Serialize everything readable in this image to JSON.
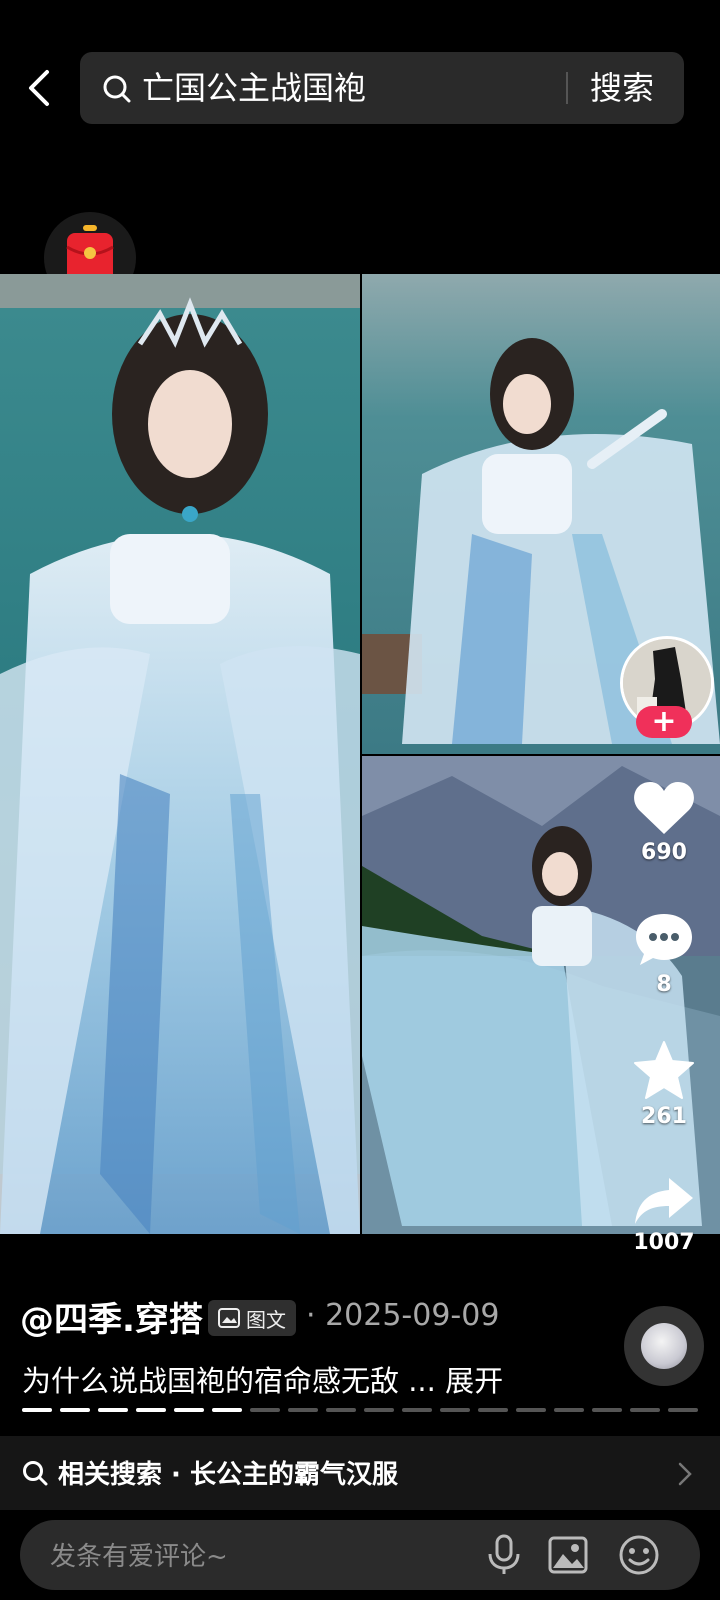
{
  "header": {
    "query": "亡国公主战国袍",
    "search_label": "搜索"
  },
  "post": {
    "author": "@四季.穿搭",
    "type_badge": "图文",
    "date": "· 2025-09-09",
    "description": "为什么说战国袍的宿命感无敌 ... 展开",
    "progress": {
      "total": 18,
      "current": 6
    }
  },
  "actions": {
    "likes": "690",
    "comments": "8",
    "favorites": "261",
    "shares": "1007"
  },
  "related": {
    "text": "相关搜索 · 长公主的霸气汉服"
  },
  "comment_bar": {
    "placeholder": "发条有爱评论~"
  },
  "colors": {
    "accent_follow": "#f0305a",
    "background": "#000000",
    "search_box": "#2a2a2a",
    "red_packet": "#e8232e"
  },
  "icons": [
    "back-arrow-icon",
    "search-icon",
    "red-packet-icon",
    "heart-icon",
    "comment-icon",
    "star-icon",
    "share-icon",
    "image-text-icon",
    "mic-icon",
    "image-icon",
    "emoji-icon",
    "chevron-right-icon"
  ]
}
